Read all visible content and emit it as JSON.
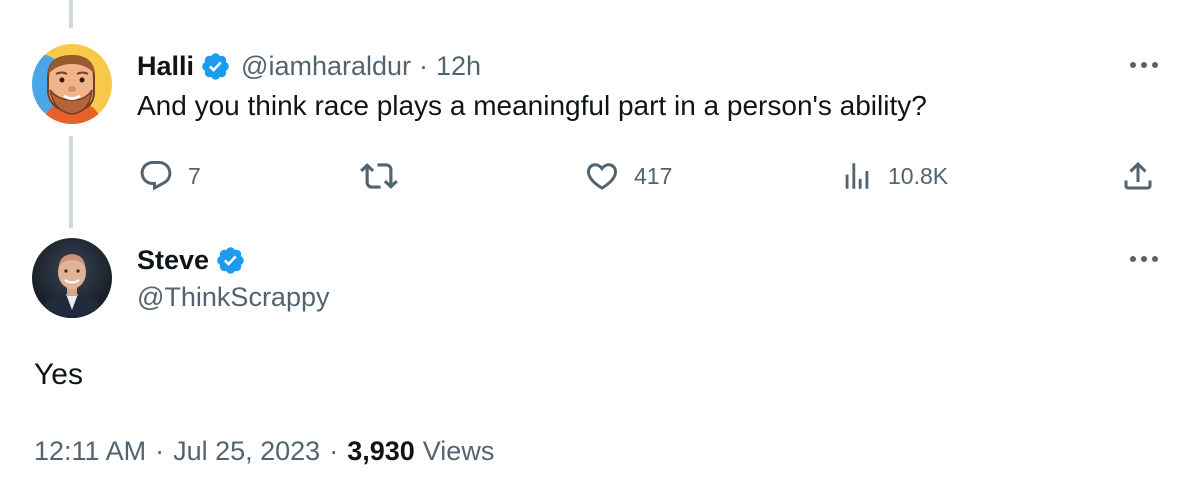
{
  "parent_tweet": {
    "display_name": "Halli",
    "handle": "@iamharaldur",
    "separator": "·",
    "time": "12h",
    "text": "And you think race plays a meaningful part in a person's ability?",
    "avatar_icon": "cartoon-avatar-icon",
    "actions": {
      "replies": "7",
      "reposts": "",
      "likes": "417",
      "views": "10.8K"
    }
  },
  "main_tweet": {
    "display_name": "Steve",
    "handle": "@ThinkScrappy",
    "avatar_icon": "photo-avatar-icon",
    "text": "Yes",
    "time": "12:11 AM",
    "separator": "·",
    "date": "Jul 25, 2023",
    "views_count": "3,930",
    "views_label": "Views"
  },
  "colors": {
    "verified": "#1d9bf0",
    "secondary_text": "#536471",
    "primary_text": "#0f1419",
    "thread_line": "#cfd9de"
  }
}
